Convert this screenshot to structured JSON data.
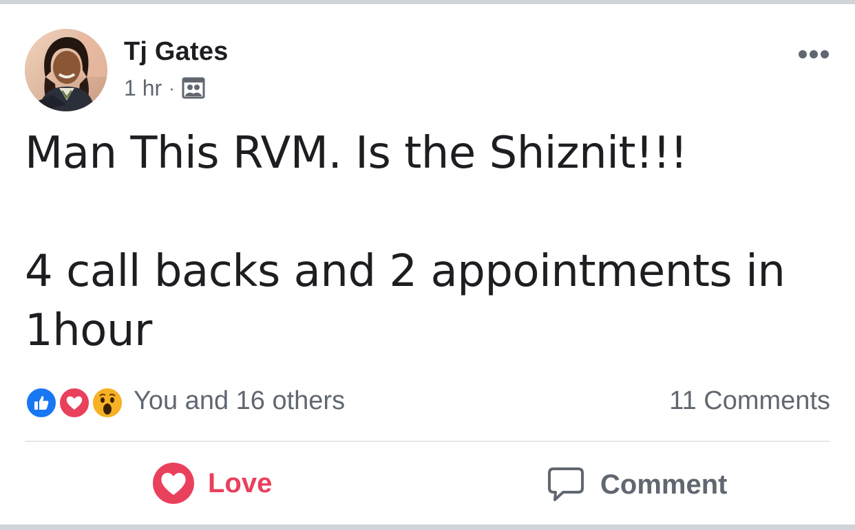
{
  "post": {
    "author": {
      "name": "Tj Gates",
      "avatar_icon": "profile-photo"
    },
    "meta": {
      "time": "1 hr",
      "separator": "·",
      "audience_icon": "friends-audience-icon"
    },
    "body": {
      "line1": "Man This RVM. Is the Shiznit!!!",
      "line2": "4 call backs and 2 appointments in 1hour"
    },
    "reactions": {
      "icons": [
        "like-icon",
        "love-icon",
        "wow-icon"
      ],
      "summary": "You and 16 others"
    },
    "comments_count": "11 Comments",
    "actions": {
      "love_label": "Love",
      "comment_label": "Comment"
    }
  },
  "colors": {
    "love": "#e9405c",
    "like": "#1877f2",
    "wow": "#f7b125",
    "secondary_text": "#606770",
    "primary_text": "#1c1e21",
    "divider": "#e4e6eb",
    "frame": "#d0d3d8"
  }
}
